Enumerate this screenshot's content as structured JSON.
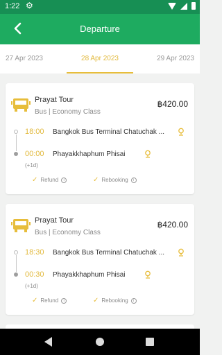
{
  "status_bar": {
    "time": "1:22"
  },
  "app_bar": {
    "title": "Departure"
  },
  "date_tabs": {
    "prev": "27 Apr 2023",
    "active": "28 Apr 2023",
    "next": "29 Apr 2023"
  },
  "trips": [
    {
      "operator": "Prayat Tour",
      "bus_class": "Bus | Economy Class",
      "price": "฿420.00",
      "departure_time": "18:00",
      "departure_place": "Bangkok Bus Terminal Chatuchak ...",
      "arrival_time": "00:00",
      "arrival_place": "Phayakkhaphum Phisai",
      "day_offset": "(+1d)",
      "refund_label": "Refund",
      "rebooking_label": "Rebooking"
    },
    {
      "operator": "Prayat Tour",
      "bus_class": "Bus | Economy Class",
      "price": "฿420.00",
      "departure_time": "18:30",
      "departure_place": "Bangkok Bus Terminal Chatuchak ...",
      "arrival_time": "00:30",
      "arrival_place": "Phayakkhaphum Phisai",
      "day_offset": "(+1d)",
      "refund_label": "Refund",
      "rebooking_label": "Rebooking"
    }
  ],
  "colors": {
    "status_bar": "#178f54",
    "app_bar": "#1eab60",
    "accent": "#e7bd3b"
  }
}
